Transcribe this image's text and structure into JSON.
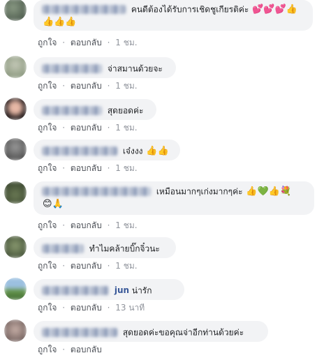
{
  "comments": [
    {
      "text": "คนดีต้องได้รับการเชิดชูเกียรติค่ะ",
      "emojis_line1": "💕💕💕👍",
      "emojis_line2": "👍👍👍",
      "like": "ถูกใจ",
      "reply": "ตอบกลับ",
      "sep": "·",
      "time": "1 ชม."
    },
    {
      "text": "จ่าสมานด้วยจะ",
      "like": "ถูกใจ",
      "reply": "ตอบกลับ",
      "sep": "·",
      "time": "1 ชม."
    },
    {
      "text": "สุดยอดค่ะ",
      "like": "ถูกใจ",
      "reply": "ตอบกลับ",
      "sep": "·",
      "time": "1 ชม."
    },
    {
      "text": "เจ๋งงง",
      "emojis": "👍👍",
      "like": "ถูกใจ",
      "reply": "ตอบกลับ",
      "sep": "·",
      "time": "1 ชม."
    },
    {
      "text": "เหมือนมากๆเก่งมากๆค่ะ",
      "emojis_line1": "👍💚👍💐",
      "emojis_line2": "😊🙏",
      "like": "ถูกใจ",
      "reply": "ตอบกลับ",
      "sep": "·",
      "time": "1 ชม."
    },
    {
      "text": "ทำไมคล้ายบิ๊กจิ๋วนะ",
      "like": "ถูกใจ",
      "reply": "ตอบกลับ",
      "sep": "·",
      "time": "1 ชม."
    },
    {
      "name_suffix": "jun",
      "text": "น่ารัก",
      "like": "ถูกใจ",
      "reply": "ตอบกลับ",
      "sep": "·",
      "time": "13 นาที"
    },
    {
      "text": "สุดยอดค่ะขอคุณจ่าอีกท่านด้วยค่ะ",
      "like": "ถูกใจ",
      "reply": "ตอบกลับ",
      "sep": "·",
      "time": ""
    }
  ]
}
